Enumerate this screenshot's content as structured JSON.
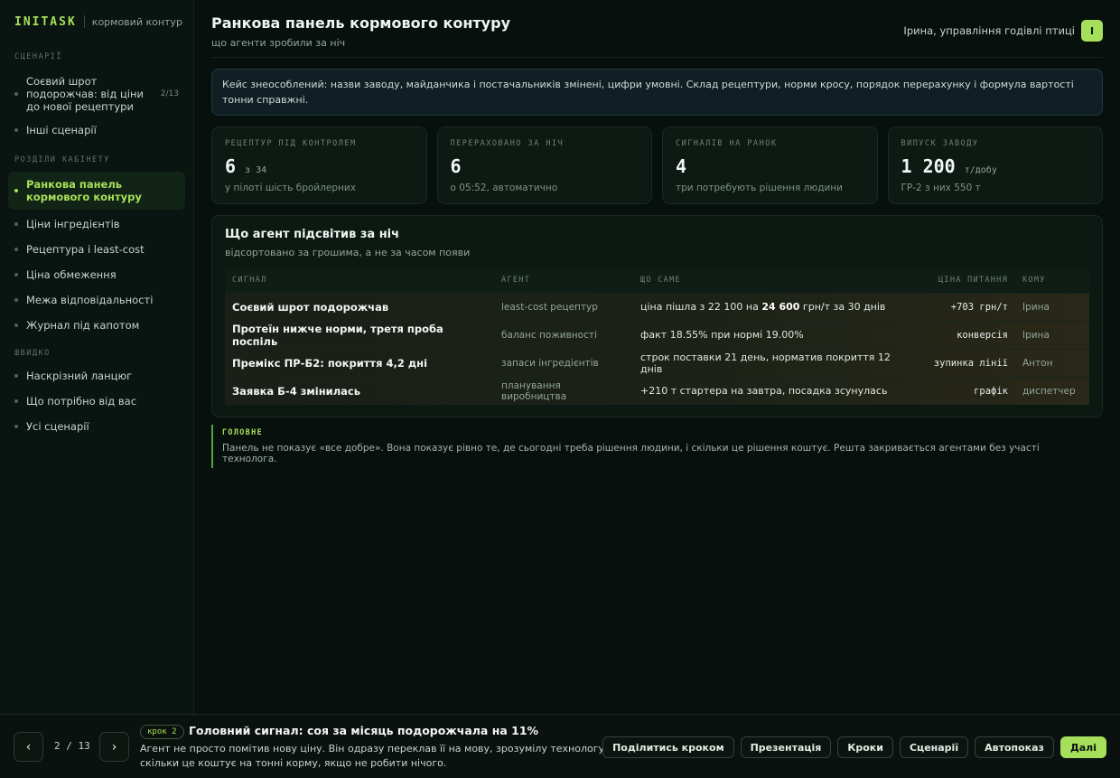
{
  "brand": {
    "logo": "INITASK",
    "subtitle": "кормовий контур"
  },
  "sidebar": {
    "scenarios_label": "СЦЕНАРІЇ",
    "scenarios": [
      {
        "label": "Соєвий шрот подорожчав: від ціни до нової рецептури",
        "count": "2/13"
      },
      {
        "label": "Інші сценарії"
      }
    ],
    "sections_label": "РОЗДІЛИ КАБІНЕТУ",
    "sections": [
      {
        "label": "Ранкова панель кормового контуру",
        "active": true
      },
      {
        "label": "Ціни інгредієнтів"
      },
      {
        "label": "Рецептура і least-cost"
      },
      {
        "label": "Ціна обмеження"
      },
      {
        "label": "Межа відповідальності"
      },
      {
        "label": "Журнал під капотом"
      }
    ],
    "quick_label": "ШВИДКО",
    "quick": [
      {
        "label": "Наскрізний ланцюг"
      },
      {
        "label": "Що потрібно від вас"
      },
      {
        "label": "Усі сценарії"
      }
    ]
  },
  "header": {
    "title": "Ранкова панель кормового контуру",
    "subtitle": "що агенти зробили за ніч",
    "user_name": "Ірина, управління годівлі птиці",
    "avatar": "І"
  },
  "notice": "Кейс знеособлений: назви заводу, майданчика і постачальників змінені, цифри умовні. Склад рецептури, норми кросу, порядок перерахунку і формула вартості тонни справжні.",
  "kpis": [
    {
      "label": "РЕЦЕПТУР ПІД КОНТРОЛЕМ",
      "value": "6",
      "unit": "з 34",
      "sub": "у пілоті шість бройлерних"
    },
    {
      "label": "ПЕРЕРАХОВАНО ЗА НІЧ",
      "value": "6",
      "unit": "",
      "sub": "о 05:52, автоматично"
    },
    {
      "label": "СИГНАЛІВ НА РАНОК",
      "value": "4",
      "unit": "",
      "sub": "три потребують рішення людини"
    },
    {
      "label": "ВИПУСК ЗАВОДУ",
      "value": "1 200",
      "unit": "т/добу",
      "sub": "ГР-2 з них 550 т"
    }
  ],
  "signals": {
    "title": "Що агент підсвітив за ніч",
    "subtitle": "відсортовано за грошима, а не за часом появи",
    "columns": [
      "СИГНАЛ",
      "АГЕНТ",
      "ЩО САМЕ",
      "ЦІНА ПИТАННЯ",
      "КОМУ"
    ],
    "rows": [
      {
        "signal": "Соєвий шрот подорожчав",
        "agent": "least-cost рецептур",
        "what_pre": "ціна пішла з 22 100 на ",
        "what_bold": "24 600",
        "what_post": " грн/т за 30 днів",
        "cost": "+703 грн/т",
        "to": "Ірина"
      },
      {
        "signal": "Протеїн нижче норми, третя проба поспіль",
        "agent": "баланс поживності",
        "what_pre": "факт 18.55% при нормі 19.00%",
        "what_bold": "",
        "what_post": "",
        "cost": "конверсія",
        "to": "Ірина"
      },
      {
        "signal": "Премікс ПР-Б2: покриття 4,2 дні",
        "agent": "запаси інгредієнтів",
        "what_pre": "строк поставки 21 день, норматив покриття 12 днів",
        "what_bold": "",
        "what_post": "",
        "cost": "зупинка лінії",
        "to": "Антон"
      },
      {
        "signal": "Заявка Б-4 змінилась",
        "agent": "планування виробництва",
        "what_pre": "+210 т стартера на завтра, посадка зсунулась",
        "what_bold": "",
        "what_post": "",
        "cost": "графік",
        "to": "диспетчер"
      }
    ]
  },
  "callout": {
    "label": "ГОЛОВНЕ",
    "text": "Панель не показує «все добре». Вона показує рівно те, де сьогодні треба рішення людини, і скільки це рішення коштує. Решта закривається агентами без участі технолога."
  },
  "footer": {
    "prev": "‹",
    "next": "›",
    "counter": "2 / 13",
    "step_badge": "крок 2",
    "step_title": "Головний сигнал: соя за місяць подорожчала на 11%",
    "step_desc": "Агент не просто помітив нову ціну. Він одразу переклав її на мову, зрозумілу технологу: скільки це коштує на тонні корму, якщо не робити нічого.",
    "buttons": [
      "Поділитись кроком",
      "Презентація",
      "Кроки",
      "Сценарії",
      "Автопоказ"
    ],
    "primary": "Далі"
  }
}
